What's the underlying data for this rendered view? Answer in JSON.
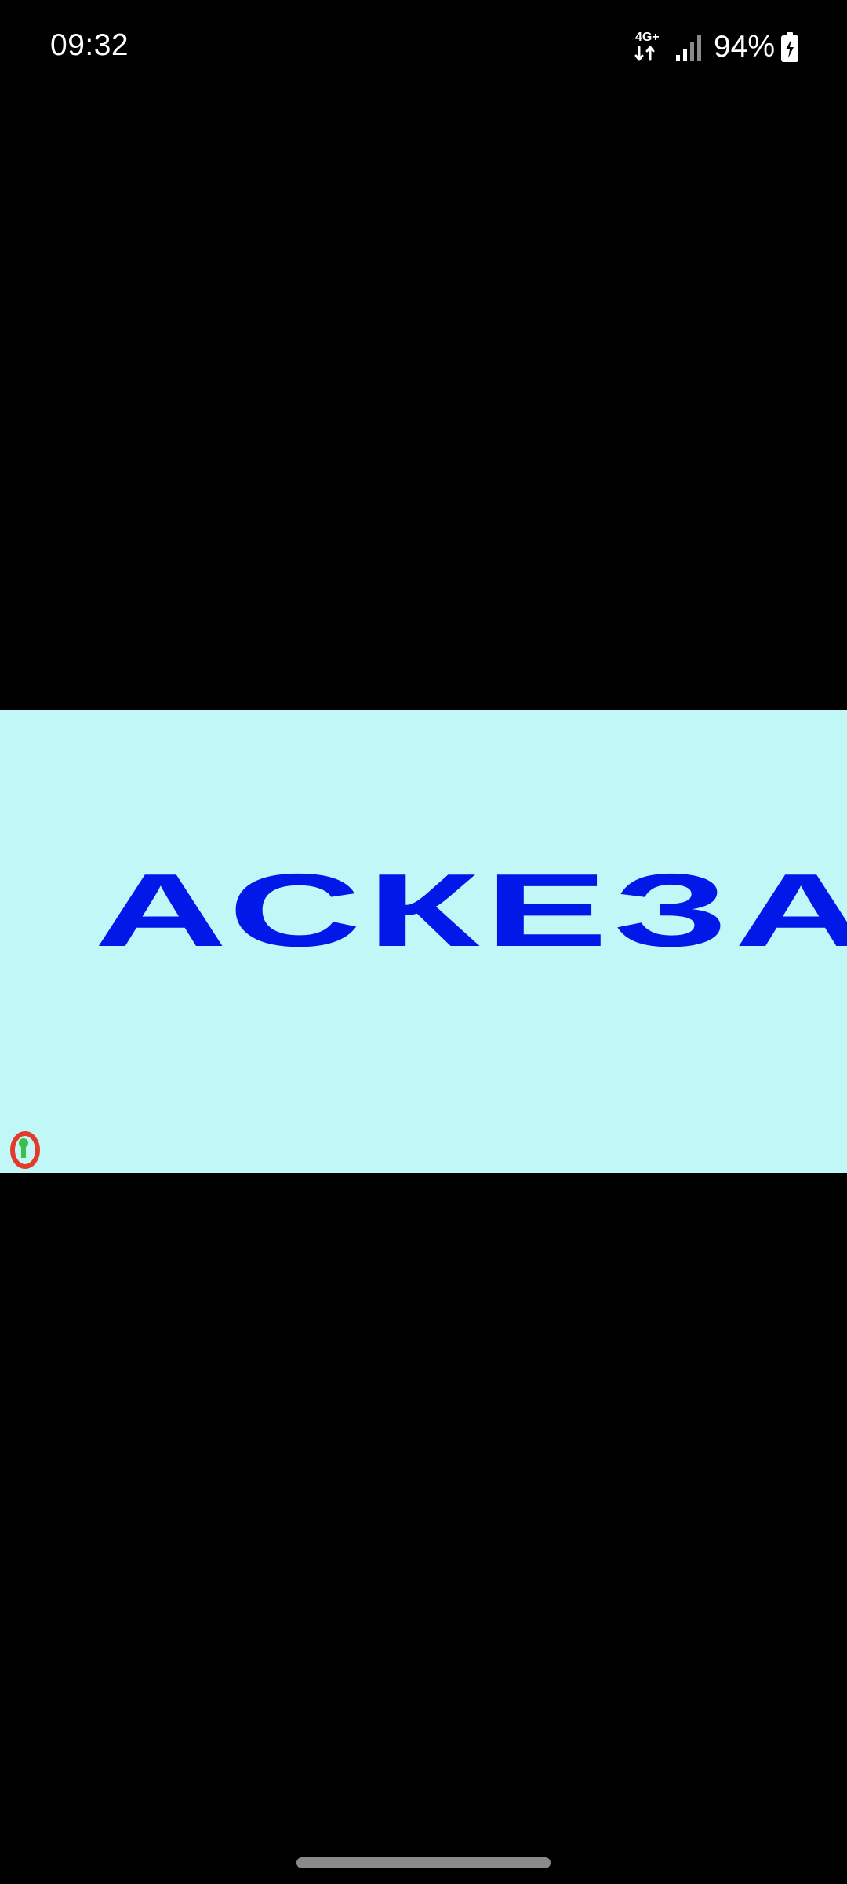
{
  "status_bar": {
    "time": "09:32",
    "network": "4G+",
    "battery_percent": "94%"
  },
  "media": {
    "title": "АСКЕЗА.",
    "title_color": "#0019e8",
    "background_color": "#c2f7f7"
  },
  "icons": {
    "network": "network-4g-icon",
    "signal": "signal-icon",
    "battery": "battery-charging-icon",
    "watermark": "app-logo-icon"
  }
}
